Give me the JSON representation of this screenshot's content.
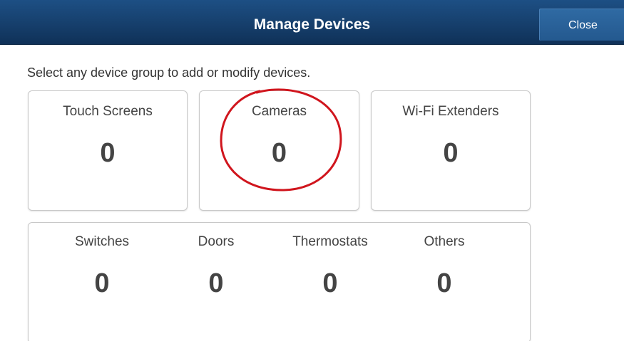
{
  "header": {
    "title": "Manage Devices",
    "close_label": "Close",
    "colors": {
      "header_bg": "#163f6c",
      "close_bg": "#2a629a"
    }
  },
  "instructions": "Select any device group to add or modify devices.",
  "groups": [
    {
      "label": "Touch Screens",
      "count": "0"
    },
    {
      "label": "Cameras",
      "count": "0"
    },
    {
      "label": "Wi-Fi Extenders",
      "count": "0"
    }
  ],
  "other_groups": [
    {
      "label": "Switches",
      "count": "0"
    },
    {
      "label": "Doors",
      "count": "0"
    },
    {
      "label": "Thermostats",
      "count": "0"
    },
    {
      "label": "Others",
      "count": "0"
    }
  ],
  "annotation": {
    "shape": "circle",
    "color": "#d0151d",
    "target": "Cameras"
  }
}
